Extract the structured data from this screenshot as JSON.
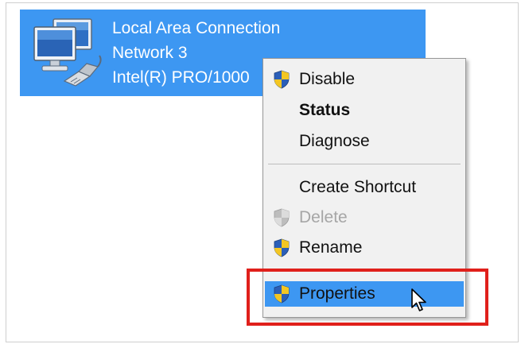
{
  "connection": {
    "name": "Local Area Connection",
    "network": "Network  3",
    "adapter": "Intel(R) PRO/1000"
  },
  "context_menu": {
    "items": [
      {
        "label": "Disable",
        "icon": "uac-shield-icon"
      },
      {
        "label": "Status"
      },
      {
        "label": "Diagnose"
      },
      {
        "label": "Create Shortcut"
      },
      {
        "label": "Delete",
        "icon": "uac-shield-icon"
      },
      {
        "label": "Rename",
        "icon": "uac-shield-icon"
      },
      {
        "label": "Properties",
        "icon": "uac-shield-icon"
      }
    ]
  },
  "colors": {
    "selection": "#3d97f2",
    "annotation": "#e0201b"
  }
}
